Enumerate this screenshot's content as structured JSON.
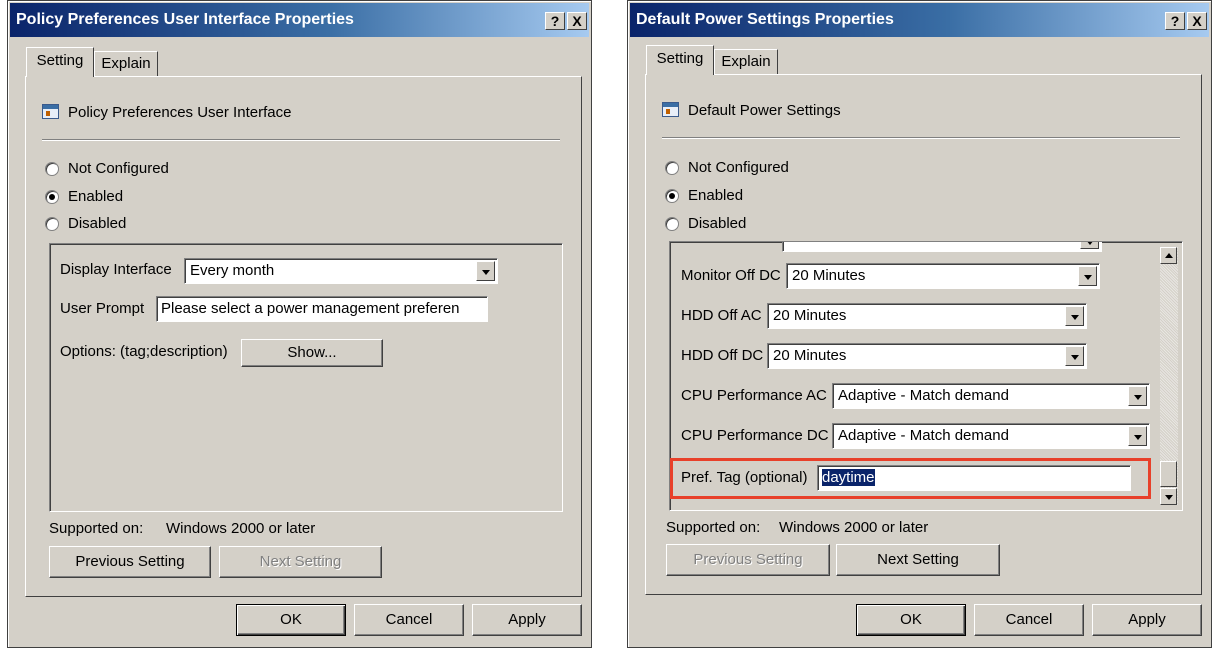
{
  "left": {
    "title": "Policy Preferences User Interface Properties",
    "help_btn": "?",
    "close_btn": "X",
    "tabs": [
      "Setting",
      "Explain"
    ],
    "policy_name": "Policy Preferences User Interface",
    "radios": [
      "Not Configured",
      "Enabled",
      "Disabled"
    ],
    "selected_radio": "Enabled",
    "display_interface_label": "Display Interface",
    "display_interface_value": "Every month",
    "user_prompt_label": "User Prompt",
    "user_prompt_value": "Please select a power management preferen",
    "options_label": "Options: (tag;description)",
    "show_button": "Show...",
    "supported_label": "Supported on:",
    "supported_value": "Windows 2000 or later",
    "previous_setting": "Previous Setting",
    "next_setting": "Next Setting",
    "ok": "OK",
    "cancel": "Cancel",
    "apply": "Apply"
  },
  "right": {
    "title": "Default Power Settings Properties",
    "help_btn": "?",
    "close_btn": "X",
    "tabs": [
      "Setting",
      "Explain"
    ],
    "policy_name": "Default Power Settings",
    "radios": [
      "Not Configured",
      "Enabled",
      "Disabled"
    ],
    "selected_radio": "Enabled",
    "rows": [
      {
        "label": "Monitor Off DC",
        "value": "20 Minutes"
      },
      {
        "label": "HDD Off AC",
        "value": "20 Minutes"
      },
      {
        "label": "HDD Off DC",
        "value": "20 Minutes"
      },
      {
        "label": "CPU Performance AC",
        "value": "Adaptive - Match demand"
      },
      {
        "label": "CPU Performance DC",
        "value": "Adaptive - Match demand"
      }
    ],
    "pref_tag_label": "Pref. Tag (optional)",
    "pref_tag_value": "daytime",
    "supported_label": "Supported on:",
    "supported_value": "Windows 2000 or later",
    "previous_setting": "Previous Setting",
    "next_setting": "Next Setting",
    "ok": "OK",
    "cancel": "Cancel",
    "apply": "Apply",
    "highlight_color": "#e8402a"
  }
}
